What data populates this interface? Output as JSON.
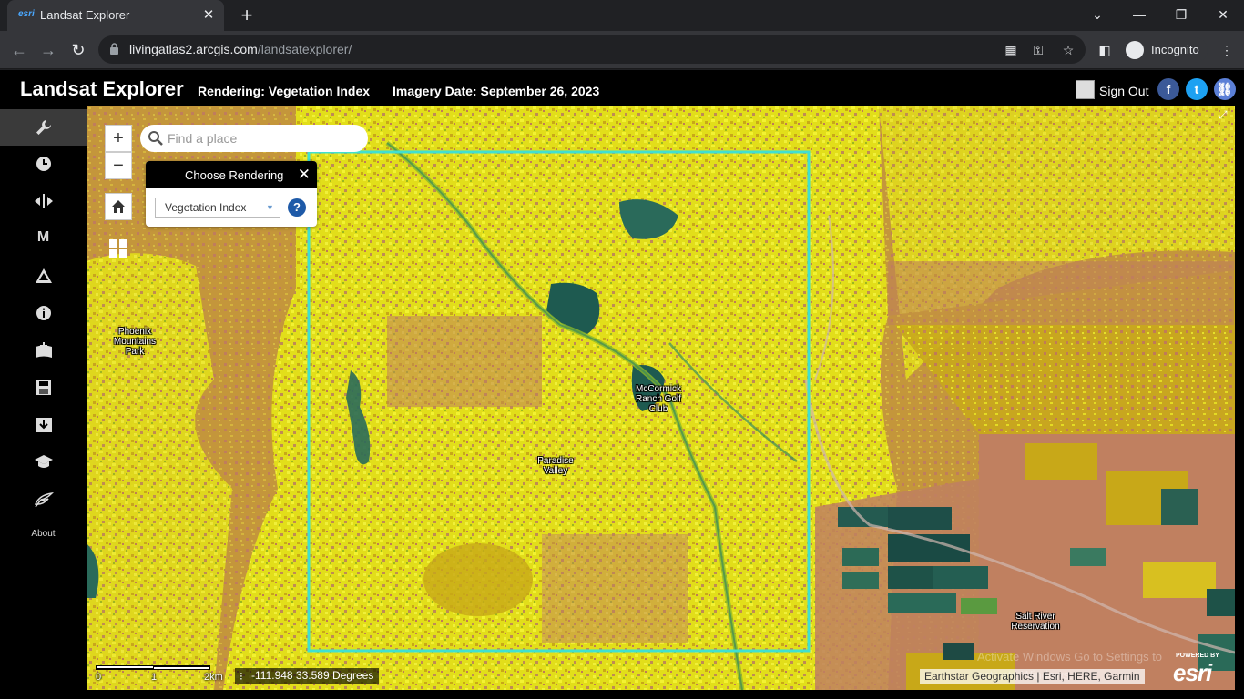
{
  "browser": {
    "tab_title": "Landsat Explorer",
    "tab_favicon": "esri",
    "url_host": "livingatlas2.arcgis.com",
    "url_path": "/landsatexplorer/",
    "profile_label": "Incognito"
  },
  "header": {
    "app_title": "Landsat Explorer",
    "rendering": "Rendering: Vegetation Index",
    "imagery_date": "Imagery Date: September 26, 2023",
    "sign_out": "Sign Out"
  },
  "sidebar": {
    "items": [
      {
        "icon": "wrench-icon"
      },
      {
        "icon": "clock-icon"
      },
      {
        "icon": "swipe-icon"
      },
      {
        "icon": "mask-icon",
        "glyph": "M"
      },
      {
        "icon": "triangle-icon"
      },
      {
        "icon": "info-icon"
      },
      {
        "icon": "bookmark-add-icon"
      },
      {
        "icon": "save-icon"
      },
      {
        "icon": "download-icon"
      },
      {
        "icon": "education-icon"
      },
      {
        "icon": "feedback-icon"
      }
    ],
    "about_label": "About"
  },
  "map": {
    "search_placeholder": "Find a place",
    "rendering_panel_title": "Choose Rendering",
    "rendering_selected": "Vegetation Index",
    "zoom_in": "+",
    "zoom_out": "−",
    "places": [
      {
        "label": "Phoenix Mountains Park"
      },
      {
        "label": "McCormick Ranch Golf Club"
      },
      {
        "label": "Paradise Valley"
      },
      {
        "label": "Salt River Reservation"
      }
    ],
    "scale_labels": [
      "0",
      "1",
      "2km"
    ],
    "coordinates": "-111.948 33.589 Degrees",
    "attribution": "Earthstar Geographics | Esri, HERE, Garmin",
    "esri_powered": "POWERED BY",
    "esri_brand": "esri",
    "watermark": "Activate Windows Go to Settings to activate Windows."
  },
  "colors": {
    "header_bg": "#000000",
    "map_brown": "#c08060",
    "map_ochre": "#c8a818",
    "map_yellow": "#e6e61a",
    "map_dark_green": "#1e5a50",
    "aoi_outline": "#40e0d0",
    "facebook": "#3b5998",
    "twitter": "#1da1f2",
    "link": "#5b7fd6"
  }
}
